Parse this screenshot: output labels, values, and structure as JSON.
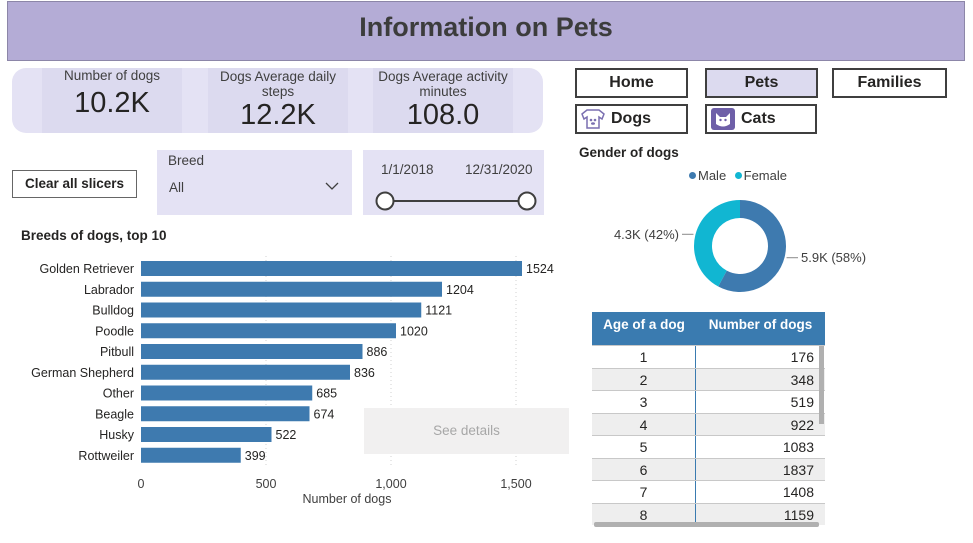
{
  "header": {
    "title": "Information on Pets"
  },
  "kpis": [
    {
      "label": "Number of dogs",
      "value": "10.2K"
    },
    {
      "label": "Dogs Average daily steps",
      "value": "12.2K"
    },
    {
      "label": "Dogs Average activity minutes",
      "value": "108.0"
    }
  ],
  "nav": {
    "home": "Home",
    "pets": "Pets",
    "families": "Families",
    "dogs": "Dogs",
    "cats": "Cats"
  },
  "slicers": {
    "clear_label": "Clear all slicers",
    "breed_title": "Breed",
    "breed_value": "All",
    "date_start": "1/1/2018",
    "date_end": "12/31/2020"
  },
  "see_details": "See details",
  "gender": {
    "title": "Gender of dogs",
    "legend": [
      {
        "name": "Male",
        "color": "#3e7aaf"
      },
      {
        "name": "Female",
        "color": "#11b6d2"
      }
    ]
  },
  "age_table": {
    "headers": [
      "Age of a dog",
      "Number of dogs"
    ],
    "rows": [
      [
        "1",
        "176"
      ],
      [
        "2",
        "348"
      ],
      [
        "3",
        "519"
      ],
      [
        "4",
        "922"
      ],
      [
        "5",
        "1083"
      ],
      [
        "6",
        "1837"
      ],
      [
        "7",
        "1408"
      ],
      [
        "8",
        "1159"
      ]
    ]
  },
  "chart_data": [
    {
      "type": "bar",
      "orientation": "horizontal",
      "title": "Breeds of dogs, top 10",
      "xlabel": "Number of dogs",
      "ylabel": "",
      "xlim": [
        0,
        1600
      ],
      "xticks": [
        0,
        500,
        1000,
        1500
      ],
      "xtick_labels": [
        "0",
        "500",
        "1,000",
        "1,500"
      ],
      "grid": true,
      "color": "#3e7aaf",
      "categories": [
        "Golden Retriever",
        "Labrador",
        "Bulldog",
        "Poodle",
        "Pitbull",
        "German Shepherd",
        "Other",
        "Beagle",
        "Husky",
        "Rottweiler"
      ],
      "values": [
        1524,
        1204,
        1121,
        1020,
        886,
        836,
        685,
        674,
        522,
        399
      ]
    },
    {
      "type": "pie",
      "style": "donut",
      "title": "Gender of dogs",
      "legend_position": "top",
      "series": [
        {
          "name": "Male",
          "value": 5900,
          "label": "5.9K (58%)",
          "color": "#3e7aaf"
        },
        {
          "name": "Female",
          "value": 4300,
          "label": "4.3K (42%)",
          "color": "#11b6d2"
        }
      ]
    }
  ]
}
